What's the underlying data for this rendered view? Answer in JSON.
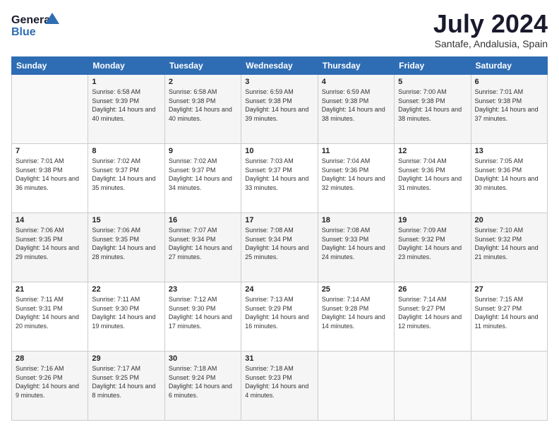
{
  "header": {
    "logo_general": "General",
    "logo_blue": "Blue",
    "month": "July 2024",
    "location": "Santafe, Andalusia, Spain"
  },
  "weekdays": [
    "Sunday",
    "Monday",
    "Tuesday",
    "Wednesday",
    "Thursday",
    "Friday",
    "Saturday"
  ],
  "weeks": [
    [
      {
        "day": "",
        "sunrise": "",
        "sunset": "",
        "daylight": ""
      },
      {
        "day": "1",
        "sunrise": "Sunrise: 6:58 AM",
        "sunset": "Sunset: 9:39 PM",
        "daylight": "Daylight: 14 hours and 40 minutes."
      },
      {
        "day": "2",
        "sunrise": "Sunrise: 6:58 AM",
        "sunset": "Sunset: 9:38 PM",
        "daylight": "Daylight: 14 hours and 40 minutes."
      },
      {
        "day": "3",
        "sunrise": "Sunrise: 6:59 AM",
        "sunset": "Sunset: 9:38 PM",
        "daylight": "Daylight: 14 hours and 39 minutes."
      },
      {
        "day": "4",
        "sunrise": "Sunrise: 6:59 AM",
        "sunset": "Sunset: 9:38 PM",
        "daylight": "Daylight: 14 hours and 38 minutes."
      },
      {
        "day": "5",
        "sunrise": "Sunrise: 7:00 AM",
        "sunset": "Sunset: 9:38 PM",
        "daylight": "Daylight: 14 hours and 38 minutes."
      },
      {
        "day": "6",
        "sunrise": "Sunrise: 7:01 AM",
        "sunset": "Sunset: 9:38 PM",
        "daylight": "Daylight: 14 hours and 37 minutes."
      }
    ],
    [
      {
        "day": "7",
        "sunrise": "Sunrise: 7:01 AM",
        "sunset": "Sunset: 9:38 PM",
        "daylight": "Daylight: 14 hours and 36 minutes."
      },
      {
        "day": "8",
        "sunrise": "Sunrise: 7:02 AM",
        "sunset": "Sunset: 9:37 PM",
        "daylight": "Daylight: 14 hours and 35 minutes."
      },
      {
        "day": "9",
        "sunrise": "Sunrise: 7:02 AM",
        "sunset": "Sunset: 9:37 PM",
        "daylight": "Daylight: 14 hours and 34 minutes."
      },
      {
        "day": "10",
        "sunrise": "Sunrise: 7:03 AM",
        "sunset": "Sunset: 9:37 PM",
        "daylight": "Daylight: 14 hours and 33 minutes."
      },
      {
        "day": "11",
        "sunrise": "Sunrise: 7:04 AM",
        "sunset": "Sunset: 9:36 PM",
        "daylight": "Daylight: 14 hours and 32 minutes."
      },
      {
        "day": "12",
        "sunrise": "Sunrise: 7:04 AM",
        "sunset": "Sunset: 9:36 PM",
        "daylight": "Daylight: 14 hours and 31 minutes."
      },
      {
        "day": "13",
        "sunrise": "Sunrise: 7:05 AM",
        "sunset": "Sunset: 9:36 PM",
        "daylight": "Daylight: 14 hours and 30 minutes."
      }
    ],
    [
      {
        "day": "14",
        "sunrise": "Sunrise: 7:06 AM",
        "sunset": "Sunset: 9:35 PM",
        "daylight": "Daylight: 14 hours and 29 minutes."
      },
      {
        "day": "15",
        "sunrise": "Sunrise: 7:06 AM",
        "sunset": "Sunset: 9:35 PM",
        "daylight": "Daylight: 14 hours and 28 minutes."
      },
      {
        "day": "16",
        "sunrise": "Sunrise: 7:07 AM",
        "sunset": "Sunset: 9:34 PM",
        "daylight": "Daylight: 14 hours and 27 minutes."
      },
      {
        "day": "17",
        "sunrise": "Sunrise: 7:08 AM",
        "sunset": "Sunset: 9:34 PM",
        "daylight": "Daylight: 14 hours and 25 minutes."
      },
      {
        "day": "18",
        "sunrise": "Sunrise: 7:08 AM",
        "sunset": "Sunset: 9:33 PM",
        "daylight": "Daylight: 14 hours and 24 minutes."
      },
      {
        "day": "19",
        "sunrise": "Sunrise: 7:09 AM",
        "sunset": "Sunset: 9:32 PM",
        "daylight": "Daylight: 14 hours and 23 minutes."
      },
      {
        "day": "20",
        "sunrise": "Sunrise: 7:10 AM",
        "sunset": "Sunset: 9:32 PM",
        "daylight": "Daylight: 14 hours and 21 minutes."
      }
    ],
    [
      {
        "day": "21",
        "sunrise": "Sunrise: 7:11 AM",
        "sunset": "Sunset: 9:31 PM",
        "daylight": "Daylight: 14 hours and 20 minutes."
      },
      {
        "day": "22",
        "sunrise": "Sunrise: 7:11 AM",
        "sunset": "Sunset: 9:30 PM",
        "daylight": "Daylight: 14 hours and 19 minutes."
      },
      {
        "day": "23",
        "sunrise": "Sunrise: 7:12 AM",
        "sunset": "Sunset: 9:30 PM",
        "daylight": "Daylight: 14 hours and 17 minutes."
      },
      {
        "day": "24",
        "sunrise": "Sunrise: 7:13 AM",
        "sunset": "Sunset: 9:29 PM",
        "daylight": "Daylight: 14 hours and 16 minutes."
      },
      {
        "day": "25",
        "sunrise": "Sunrise: 7:14 AM",
        "sunset": "Sunset: 9:28 PM",
        "daylight": "Daylight: 14 hours and 14 minutes."
      },
      {
        "day": "26",
        "sunrise": "Sunrise: 7:14 AM",
        "sunset": "Sunset: 9:27 PM",
        "daylight": "Daylight: 14 hours and 12 minutes."
      },
      {
        "day": "27",
        "sunrise": "Sunrise: 7:15 AM",
        "sunset": "Sunset: 9:27 PM",
        "daylight": "Daylight: 14 hours and 11 minutes."
      }
    ],
    [
      {
        "day": "28",
        "sunrise": "Sunrise: 7:16 AM",
        "sunset": "Sunset: 9:26 PM",
        "daylight": "Daylight: 14 hours and 9 minutes."
      },
      {
        "day": "29",
        "sunrise": "Sunrise: 7:17 AM",
        "sunset": "Sunset: 9:25 PM",
        "daylight": "Daylight: 14 hours and 8 minutes."
      },
      {
        "day": "30",
        "sunrise": "Sunrise: 7:18 AM",
        "sunset": "Sunset: 9:24 PM",
        "daylight": "Daylight: 14 hours and 6 minutes."
      },
      {
        "day": "31",
        "sunrise": "Sunrise: 7:18 AM",
        "sunset": "Sunset: 9:23 PM",
        "daylight": "Daylight: 14 hours and 4 minutes."
      },
      {
        "day": "",
        "sunrise": "",
        "sunset": "",
        "daylight": ""
      },
      {
        "day": "",
        "sunrise": "",
        "sunset": "",
        "daylight": ""
      },
      {
        "day": "",
        "sunrise": "",
        "sunset": "",
        "daylight": ""
      }
    ]
  ]
}
